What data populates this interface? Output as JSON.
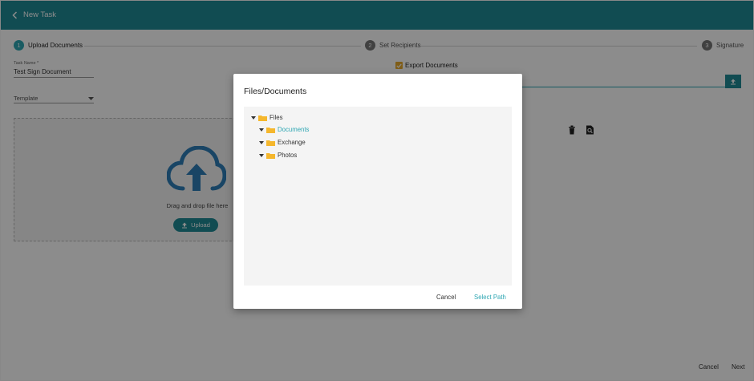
{
  "header": {
    "title": "New Task"
  },
  "steps": [
    {
      "num": "1",
      "label": "Upload Documents"
    },
    {
      "num": "2",
      "label": "Set Recipients"
    },
    {
      "num": "3",
      "label": "Signature"
    }
  ],
  "form": {
    "task_name_label": "Task Name *",
    "task_name_value": "Test Sign Document",
    "template_label": "Template",
    "dropzone_text": "Drag and drop file here",
    "upload_label": "Upload",
    "export_label": "Export Documents",
    "export_checked": true
  },
  "footer": {
    "cancel_label": "Cancel",
    "next_label": "Next"
  },
  "modal": {
    "title": "Files/Documents",
    "tree": {
      "root": "Files",
      "children": [
        "Documents",
        "Exchange",
        "Photos"
      ],
      "selected": "Documents"
    },
    "cancel_label": "Cancel",
    "select_label": "Select Path"
  },
  "colors": {
    "header": "#1f8a95",
    "accent": "#2fa7b3",
    "folder": "#f5b72d",
    "checkbox": "#e8a92d"
  }
}
